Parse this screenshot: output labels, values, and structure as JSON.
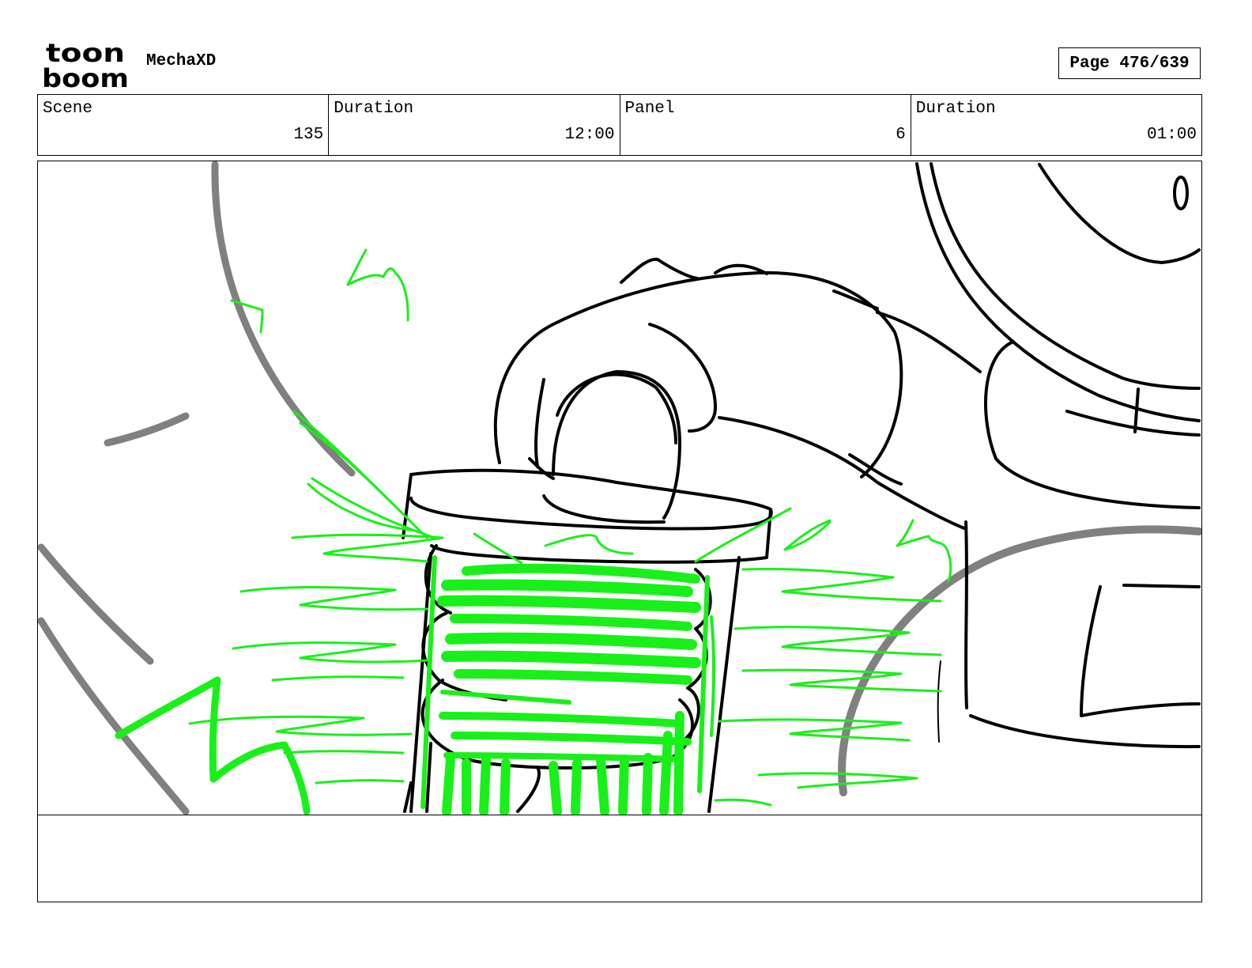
{
  "header": {
    "logo_line1": "toon",
    "logo_line2": "boom",
    "project_title": "MechaXD",
    "page_label": "Page 476/639"
  },
  "info": [
    {
      "label": "Scene",
      "value": "135"
    },
    {
      "label": "Duration",
      "value": "12:00"
    },
    {
      "label": "Panel",
      "value": "6"
    },
    {
      "label": "Duration",
      "value": "01:00"
    }
  ],
  "colors": {
    "ink": "#000000",
    "gray_stroke": "#808080",
    "green_energy": "#19f019"
  },
  "notes": {
    "text": ""
  }
}
